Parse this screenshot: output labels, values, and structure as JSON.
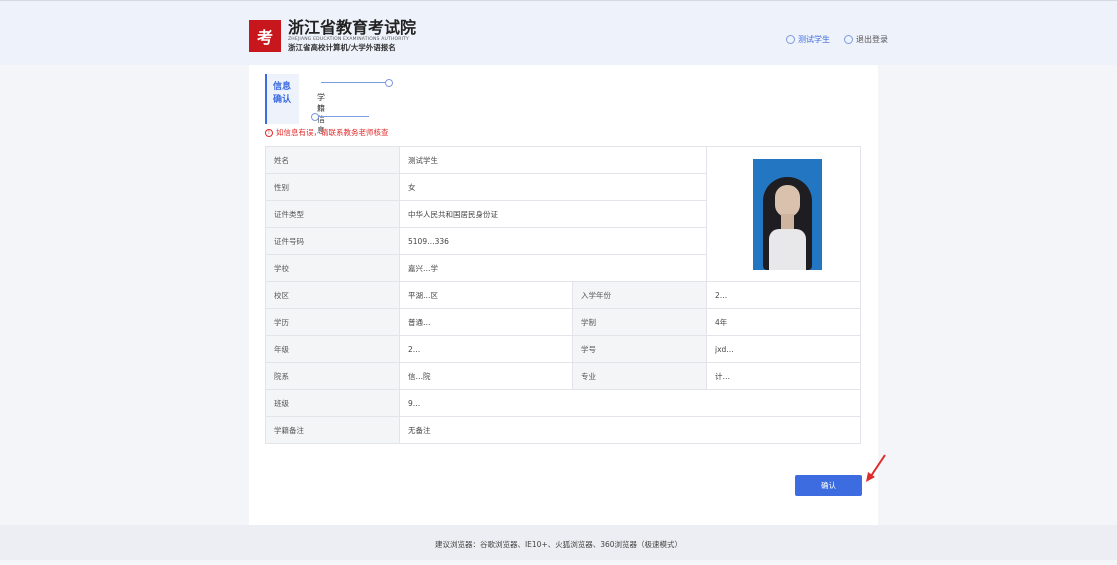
{
  "header": {
    "logo_mark": "考",
    "org_name": "浙江省教育考试院",
    "org_name_en": "ZHEJIANG EDUCATION EXAMINATIONS AUTHORITY",
    "system_name": "浙江省高校计算机/大学外语报名",
    "user_name": "测试学生",
    "logout_label": "退出登录"
  },
  "tabs": {
    "active_label": "信息确认",
    "secondary_label": "学籍信息"
  },
  "warning": "如信息有误，请联系教务老师核查",
  "rows": [
    {
      "label": "姓名",
      "value": "测试学生"
    },
    {
      "label": "性别",
      "value": "女"
    },
    {
      "label": "证件类型",
      "value": "中华人民共和国居民身份证"
    },
    {
      "label": "证件号码",
      "value": "5109…336"
    },
    {
      "label": "学校",
      "value": "嘉兴…学"
    },
    {
      "label": "校区",
      "value": "平湖…区",
      "label2": "入学年份",
      "value2": "2…"
    },
    {
      "label": "学历",
      "value": "普通…",
      "label2": "学制",
      "value2": "4年"
    },
    {
      "label": "年级",
      "value": "2…",
      "label2": "学号",
      "value2": "jxd…"
    },
    {
      "label": "院系",
      "value": "信…院",
      "label2": "专业",
      "value2": "计…"
    },
    {
      "label": "班级",
      "value": "9…"
    },
    {
      "label": "学籍备注",
      "value": "无备注"
    }
  ],
  "confirm_label": "确认",
  "footer_text": "建议浏览器：谷歌浏览器、IE10+、火狐浏览器、360浏览器（极速模式）",
  "colors": {
    "accent": "#3d6be0",
    "warning": "#e02b2b",
    "logo": "#c8161d"
  }
}
